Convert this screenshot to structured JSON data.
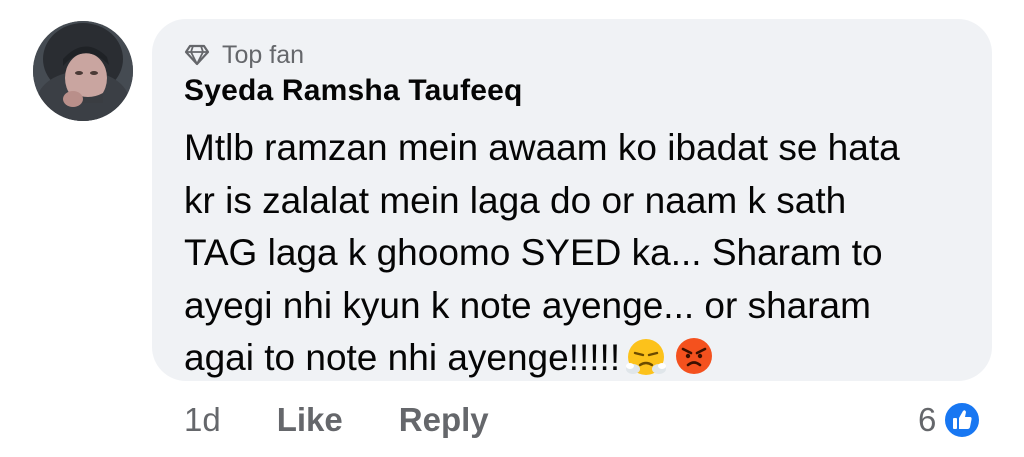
{
  "comment": {
    "badge_label": "Top fan",
    "author_name": "Syeda Ramsha Taufeeq",
    "text_lines": [
      "Mtlb ramzan mein awaam ko ibadat se hata",
      "kr is zalalat mein laga do or naam k sath",
      "TAG laga k ghoomo SYED ka... Sharam to",
      "ayegi nhi kyun k note ayenge... or sharam",
      "agai to note nhi ayenge!!!!!"
    ],
    "emojis": [
      "triumph-face-emoji",
      "angry-face-emoji"
    ]
  },
  "actions": {
    "timestamp": "1d",
    "like_label": "Like",
    "reply_label": "Reply"
  },
  "reactions": {
    "count": "6",
    "icon": "thumbs-up-icon"
  },
  "colors": {
    "bubble": "#f0f2f5",
    "text": "#050505",
    "secondary_text": "#65676b",
    "like_blue": "#1877f2"
  }
}
